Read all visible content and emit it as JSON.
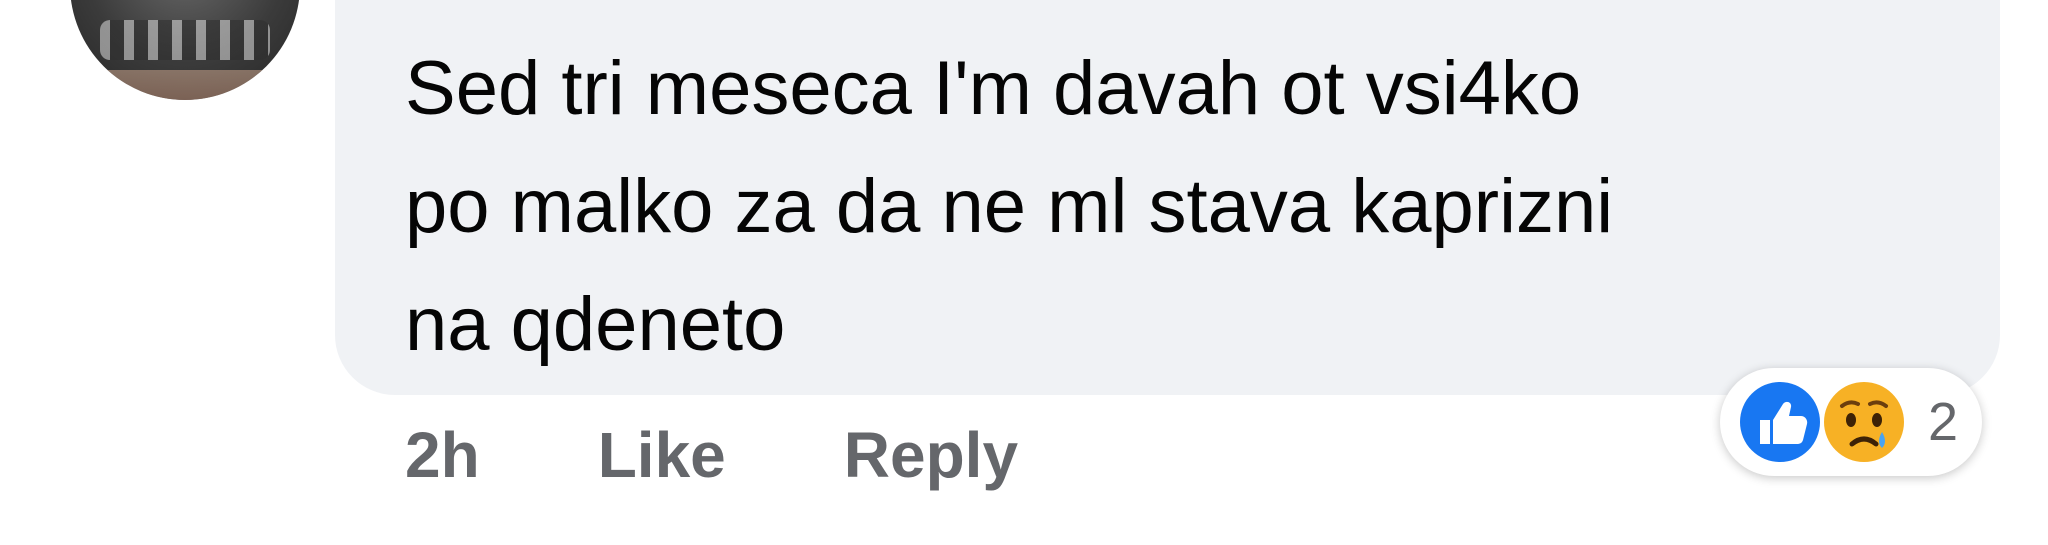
{
  "comment": {
    "text": "Sed tri meseca I'm davah ot vsi4ko\npo malko za da ne ml stava kaprizni\nna qdeneto"
  },
  "actions": {
    "time": "2h",
    "like_label": "Like",
    "reply_label": "Reply"
  },
  "reactions": {
    "icons": [
      "like-icon",
      "sad-icon"
    ],
    "count": "2"
  },
  "colors": {
    "bubble": "#f0f2f5",
    "text": "#050505",
    "secondary": "#65676b",
    "like_blue": "#1877f2",
    "sad_yellow": "#f7b125"
  }
}
